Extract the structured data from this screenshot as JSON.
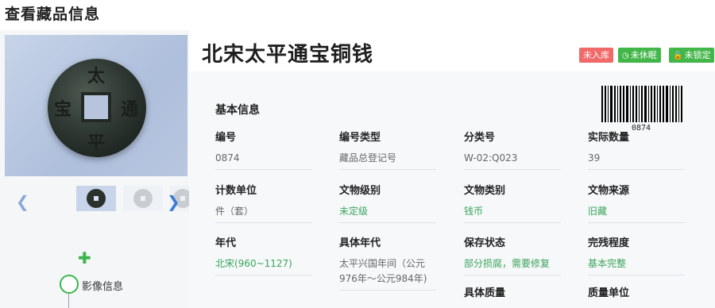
{
  "page_title": "查看藏品信息",
  "relic": {
    "title": "北宋太平通宝铜钱",
    "coin_chars": [
      "太",
      "平",
      "通",
      "宝"
    ]
  },
  "badges": {
    "not_in_storage": "未入库",
    "not_dormant": "未休眠",
    "not_locked": "未锁定"
  },
  "gallery": {
    "thumbnails": [
      "coin-front",
      "coin-back",
      "coin-partial"
    ]
  },
  "timeline": {
    "image_info": "影像信息"
  },
  "basic_info": {
    "section_title": "基本信息",
    "barcode_number": "0874",
    "fields": [
      {
        "label": "编号",
        "value": "0874"
      },
      {
        "label": "编号类型",
        "value": "藏品总登记号"
      },
      {
        "label": "分类号",
        "value": "W-02:Q023"
      },
      {
        "label": "实际数量",
        "value": "39"
      },
      {
        "label": "计数单位",
        "value": "件（套）"
      },
      {
        "label": "文物级别",
        "value": "未定级"
      },
      {
        "label": "文物类别",
        "value": "钱币"
      },
      {
        "label": "文物来源",
        "value": "旧藏"
      },
      {
        "label": "年代",
        "value": "北宋(960~1127)"
      },
      {
        "label": "具体年代",
        "value": "太平兴国年间（公元976年～公元984年)"
      },
      {
        "label": "保存状态",
        "value": "部分损腐，需要修复"
      },
      {
        "label": "完残程度",
        "value": "基本完整"
      },
      {
        "label": "具体质量",
        "value": ""
      },
      {
        "label": "质量单位",
        "value": ""
      }
    ]
  },
  "colors": {
    "accent_green": "#43b649",
    "badge_red": "#f06a6a",
    "value_green": "#3aa45a",
    "nav_blue": "#3a7bd5"
  }
}
